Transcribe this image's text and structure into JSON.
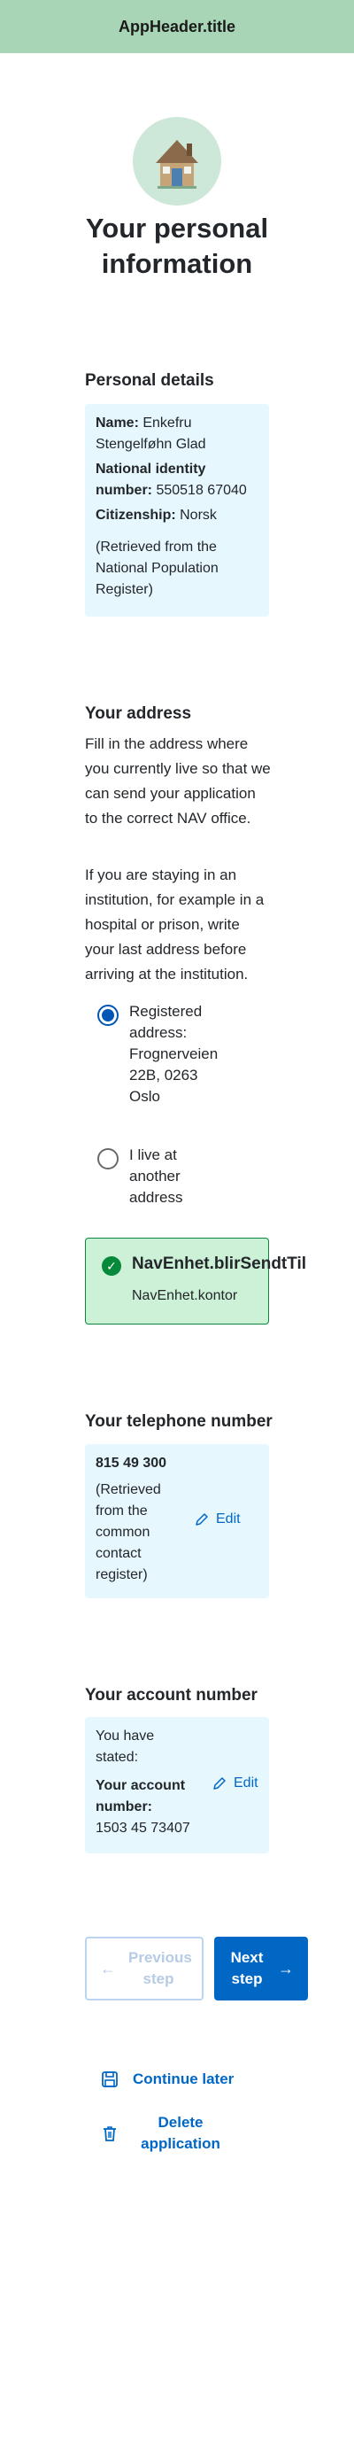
{
  "header": {
    "title": "AppHeader.title"
  },
  "page": {
    "title": "Your personal information"
  },
  "personal": {
    "heading": "Personal details",
    "name_label": "Name:",
    "name_value": "Enkefru Stengelføhn Glad",
    "id_label": "National identity number:",
    "id_value": "550518 67040",
    "citizenship_label": "Citizenship:",
    "citizenship_value": "Norsk",
    "source": "(Retrieved from the National Population Register)"
  },
  "address": {
    "heading": "Your address",
    "intro": "Fill in the address where you currently live so that we can send your application to the correct NAV office.",
    "institution": "If you are staying in an institution, for example in a hospital or prison, write your last address before arriving at the institution.",
    "option_registered": "Registered address: Frognerveien 22B, 0263 Oslo",
    "option_other": "I live at another address",
    "selected": "registered"
  },
  "success": {
    "title": "NavEnhet.blirSendtTil",
    "subtitle": "NavEnhet.kontor"
  },
  "phone": {
    "heading": "Your telephone number",
    "number": "815 49 300",
    "source": "(Retrieved from the common contact register)",
    "edit": "Edit"
  },
  "account": {
    "heading": "Your account number",
    "stated": "You have stated:",
    "label": "Your account number:",
    "number": "1503 45 73407",
    "edit": "Edit"
  },
  "nav": {
    "previous": "Previous step",
    "next": "Next step",
    "continue_later": "Continue later",
    "delete": "Delete application"
  },
  "colors": {
    "header_bg": "#a8d5b5",
    "panel_bg": "#e6f8fd",
    "accent": "#0067c5",
    "success_bg": "#ccf1d6",
    "success_border": "#06893a"
  }
}
